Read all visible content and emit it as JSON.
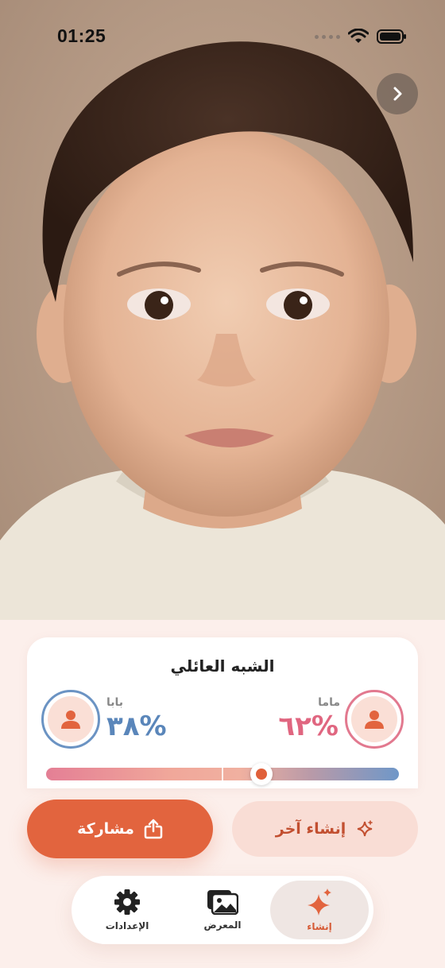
{
  "status_bar": {
    "time": "01:25"
  },
  "card": {
    "title": "الشبه العائلي",
    "mom": {
      "label": "ماما",
      "percent": "٦٢%",
      "value": 62,
      "color": "#e06680"
    },
    "dad": {
      "label": "بابا",
      "percent": "٣٨%",
      "value": 38,
      "color": "#5a86ba"
    }
  },
  "actions": {
    "share_label": "مشاركة",
    "create_another_label": "إنشاء آخر"
  },
  "tabbar": {
    "create": "إنشاء",
    "gallery": "المعرض",
    "settings": "الإعدادات"
  },
  "colors": {
    "accent": "#e2643e",
    "background": "#fcefeb"
  },
  "icons": {
    "back": "chevron-right-icon",
    "share": "share-icon",
    "create": "sparkles-icon",
    "gallery": "photos-icon",
    "settings": "gear-icon",
    "avatar": "person-icon"
  }
}
